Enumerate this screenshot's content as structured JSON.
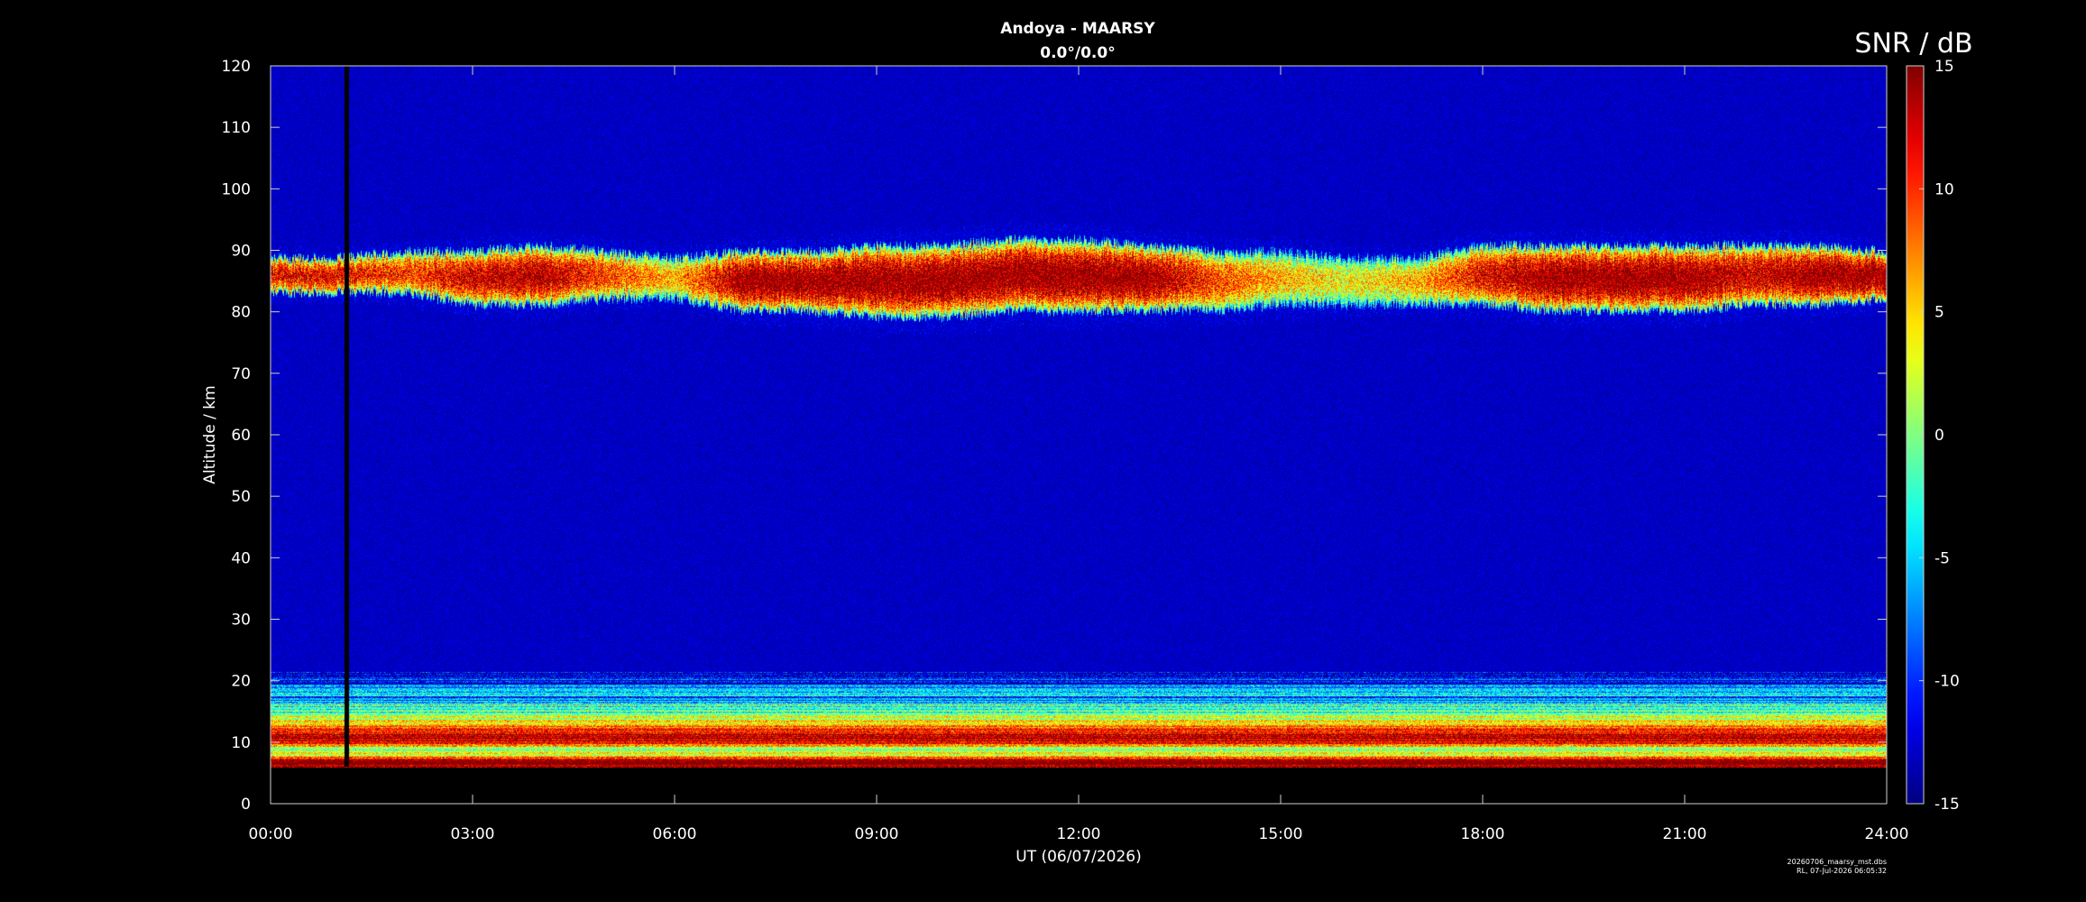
{
  "chart_data": {
    "type": "heatmap",
    "title": "Andoya - MAARSY",
    "subtitle": "0.0°/0.0°",
    "xlabel": "UT (06/07/2026)",
    "ylabel": "Altitude / km",
    "colorbar_label": "SNR / dB",
    "xlim_hours": [
      0,
      24
    ],
    "ylim_km": [
      0,
      120
    ],
    "clim_db": [
      -15,
      15
    ],
    "x_ticks": [
      "00:00",
      "03:00",
      "06:00",
      "09:00",
      "12:00",
      "15:00",
      "18:00",
      "21:00",
      "24:00"
    ],
    "x_tick_hours": [
      0,
      3,
      6,
      9,
      12,
      15,
      18,
      21,
      24
    ],
    "y_ticks": [
      0,
      10,
      20,
      30,
      40,
      50,
      60,
      70,
      80,
      90,
      100,
      110,
      120
    ],
    "colorbar_ticks": [
      15,
      10,
      5,
      0,
      -5,
      -10,
      -15
    ],
    "colormap": "jet",
    "data_gap_hour": 1.12,
    "data_lower_limit_km": 6,
    "background_snr_db": -13,
    "mesosphere_layer": {
      "time_hours": [
        0,
        1,
        2,
        3,
        4,
        5,
        6,
        7,
        8,
        9,
        10,
        11,
        12,
        13,
        14,
        15,
        16,
        17,
        18,
        19,
        20,
        21,
        22,
        23,
        24
      ],
      "bottom_km": [
        83,
        83,
        83,
        81,
        81,
        82,
        82,
        80,
        80,
        79,
        79,
        80,
        80,
        80,
        80,
        81,
        81,
        81,
        81,
        80,
        80,
        80,
        81,
        81,
        82
      ],
      "top_km": [
        89,
        89,
        90,
        90,
        91,
        90,
        89,
        90,
        90,
        91,
        91,
        92,
        92,
        91,
        90,
        90,
        89,
        89,
        91,
        91,
        91,
        91,
        91,
        91,
        90
      ],
      "peak_snr_db": [
        12,
        12,
        10,
        13,
        14,
        10,
        6,
        15,
        15,
        15,
        15,
        15,
        15,
        15,
        10,
        6,
        4,
        6,
        12,
        15,
        15,
        15,
        13,
        15,
        15
      ]
    },
    "lower_layer": {
      "altitude_km": [
        6,
        7,
        8,
        9,
        10,
        11,
        12,
        13,
        14,
        15,
        16,
        17,
        18,
        19,
        20,
        21
      ],
      "snr_db": [
        15,
        15,
        4,
        0,
        12,
        15,
        10,
        6,
        3,
        0,
        -2,
        -5,
        -7,
        -9,
        -11,
        -13
      ]
    },
    "footer_lines": [
      "20260706_maarsy_mst.dbs",
      "RL, 07-Jul-2026 06:05:32"
    ]
  }
}
